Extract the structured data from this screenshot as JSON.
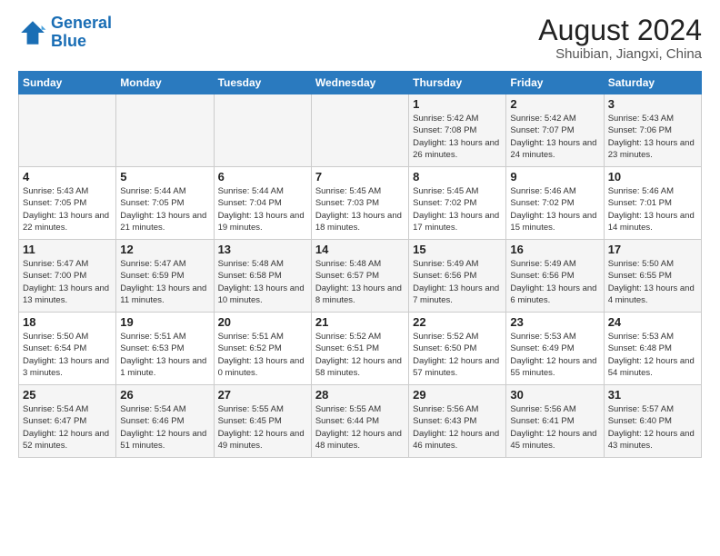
{
  "logo": {
    "line1": "General",
    "line2": "Blue"
  },
  "title": "August 2024",
  "subtitle": "Shuibian, Jiangxi, China",
  "weekdays": [
    "Sunday",
    "Monday",
    "Tuesday",
    "Wednesday",
    "Thursday",
    "Friday",
    "Saturday"
  ],
  "weeks": [
    [
      {
        "day": "",
        "info": ""
      },
      {
        "day": "",
        "info": ""
      },
      {
        "day": "",
        "info": ""
      },
      {
        "day": "",
        "info": ""
      },
      {
        "day": "1",
        "info": "Sunrise: 5:42 AM\nSunset: 7:08 PM\nDaylight: 13 hours and 26 minutes."
      },
      {
        "day": "2",
        "info": "Sunrise: 5:42 AM\nSunset: 7:07 PM\nDaylight: 13 hours and 24 minutes."
      },
      {
        "day": "3",
        "info": "Sunrise: 5:43 AM\nSunset: 7:06 PM\nDaylight: 13 hours and 23 minutes."
      }
    ],
    [
      {
        "day": "4",
        "info": "Sunrise: 5:43 AM\nSunset: 7:05 PM\nDaylight: 13 hours and 22 minutes."
      },
      {
        "day": "5",
        "info": "Sunrise: 5:44 AM\nSunset: 7:05 PM\nDaylight: 13 hours and 21 minutes."
      },
      {
        "day": "6",
        "info": "Sunrise: 5:44 AM\nSunset: 7:04 PM\nDaylight: 13 hours and 19 minutes."
      },
      {
        "day": "7",
        "info": "Sunrise: 5:45 AM\nSunset: 7:03 PM\nDaylight: 13 hours and 18 minutes."
      },
      {
        "day": "8",
        "info": "Sunrise: 5:45 AM\nSunset: 7:02 PM\nDaylight: 13 hours and 17 minutes."
      },
      {
        "day": "9",
        "info": "Sunrise: 5:46 AM\nSunset: 7:02 PM\nDaylight: 13 hours and 15 minutes."
      },
      {
        "day": "10",
        "info": "Sunrise: 5:46 AM\nSunset: 7:01 PM\nDaylight: 13 hours and 14 minutes."
      }
    ],
    [
      {
        "day": "11",
        "info": "Sunrise: 5:47 AM\nSunset: 7:00 PM\nDaylight: 13 hours and 13 minutes."
      },
      {
        "day": "12",
        "info": "Sunrise: 5:47 AM\nSunset: 6:59 PM\nDaylight: 13 hours and 11 minutes."
      },
      {
        "day": "13",
        "info": "Sunrise: 5:48 AM\nSunset: 6:58 PM\nDaylight: 13 hours and 10 minutes."
      },
      {
        "day": "14",
        "info": "Sunrise: 5:48 AM\nSunset: 6:57 PM\nDaylight: 13 hours and 8 minutes."
      },
      {
        "day": "15",
        "info": "Sunrise: 5:49 AM\nSunset: 6:56 PM\nDaylight: 13 hours and 7 minutes."
      },
      {
        "day": "16",
        "info": "Sunrise: 5:49 AM\nSunset: 6:56 PM\nDaylight: 13 hours and 6 minutes."
      },
      {
        "day": "17",
        "info": "Sunrise: 5:50 AM\nSunset: 6:55 PM\nDaylight: 13 hours and 4 minutes."
      }
    ],
    [
      {
        "day": "18",
        "info": "Sunrise: 5:50 AM\nSunset: 6:54 PM\nDaylight: 13 hours and 3 minutes."
      },
      {
        "day": "19",
        "info": "Sunrise: 5:51 AM\nSunset: 6:53 PM\nDaylight: 13 hours and 1 minute."
      },
      {
        "day": "20",
        "info": "Sunrise: 5:51 AM\nSunset: 6:52 PM\nDaylight: 13 hours and 0 minutes."
      },
      {
        "day": "21",
        "info": "Sunrise: 5:52 AM\nSunset: 6:51 PM\nDaylight: 12 hours and 58 minutes."
      },
      {
        "day": "22",
        "info": "Sunrise: 5:52 AM\nSunset: 6:50 PM\nDaylight: 12 hours and 57 minutes."
      },
      {
        "day": "23",
        "info": "Sunrise: 5:53 AM\nSunset: 6:49 PM\nDaylight: 12 hours and 55 minutes."
      },
      {
        "day": "24",
        "info": "Sunrise: 5:53 AM\nSunset: 6:48 PM\nDaylight: 12 hours and 54 minutes."
      }
    ],
    [
      {
        "day": "25",
        "info": "Sunrise: 5:54 AM\nSunset: 6:47 PM\nDaylight: 12 hours and 52 minutes."
      },
      {
        "day": "26",
        "info": "Sunrise: 5:54 AM\nSunset: 6:46 PM\nDaylight: 12 hours and 51 minutes."
      },
      {
        "day": "27",
        "info": "Sunrise: 5:55 AM\nSunset: 6:45 PM\nDaylight: 12 hours and 49 minutes."
      },
      {
        "day": "28",
        "info": "Sunrise: 5:55 AM\nSunset: 6:44 PM\nDaylight: 12 hours and 48 minutes."
      },
      {
        "day": "29",
        "info": "Sunrise: 5:56 AM\nSunset: 6:43 PM\nDaylight: 12 hours and 46 minutes."
      },
      {
        "day": "30",
        "info": "Sunrise: 5:56 AM\nSunset: 6:41 PM\nDaylight: 12 hours and 45 minutes."
      },
      {
        "day": "31",
        "info": "Sunrise: 5:57 AM\nSunset: 6:40 PM\nDaylight: 12 hours and 43 minutes."
      }
    ]
  ]
}
